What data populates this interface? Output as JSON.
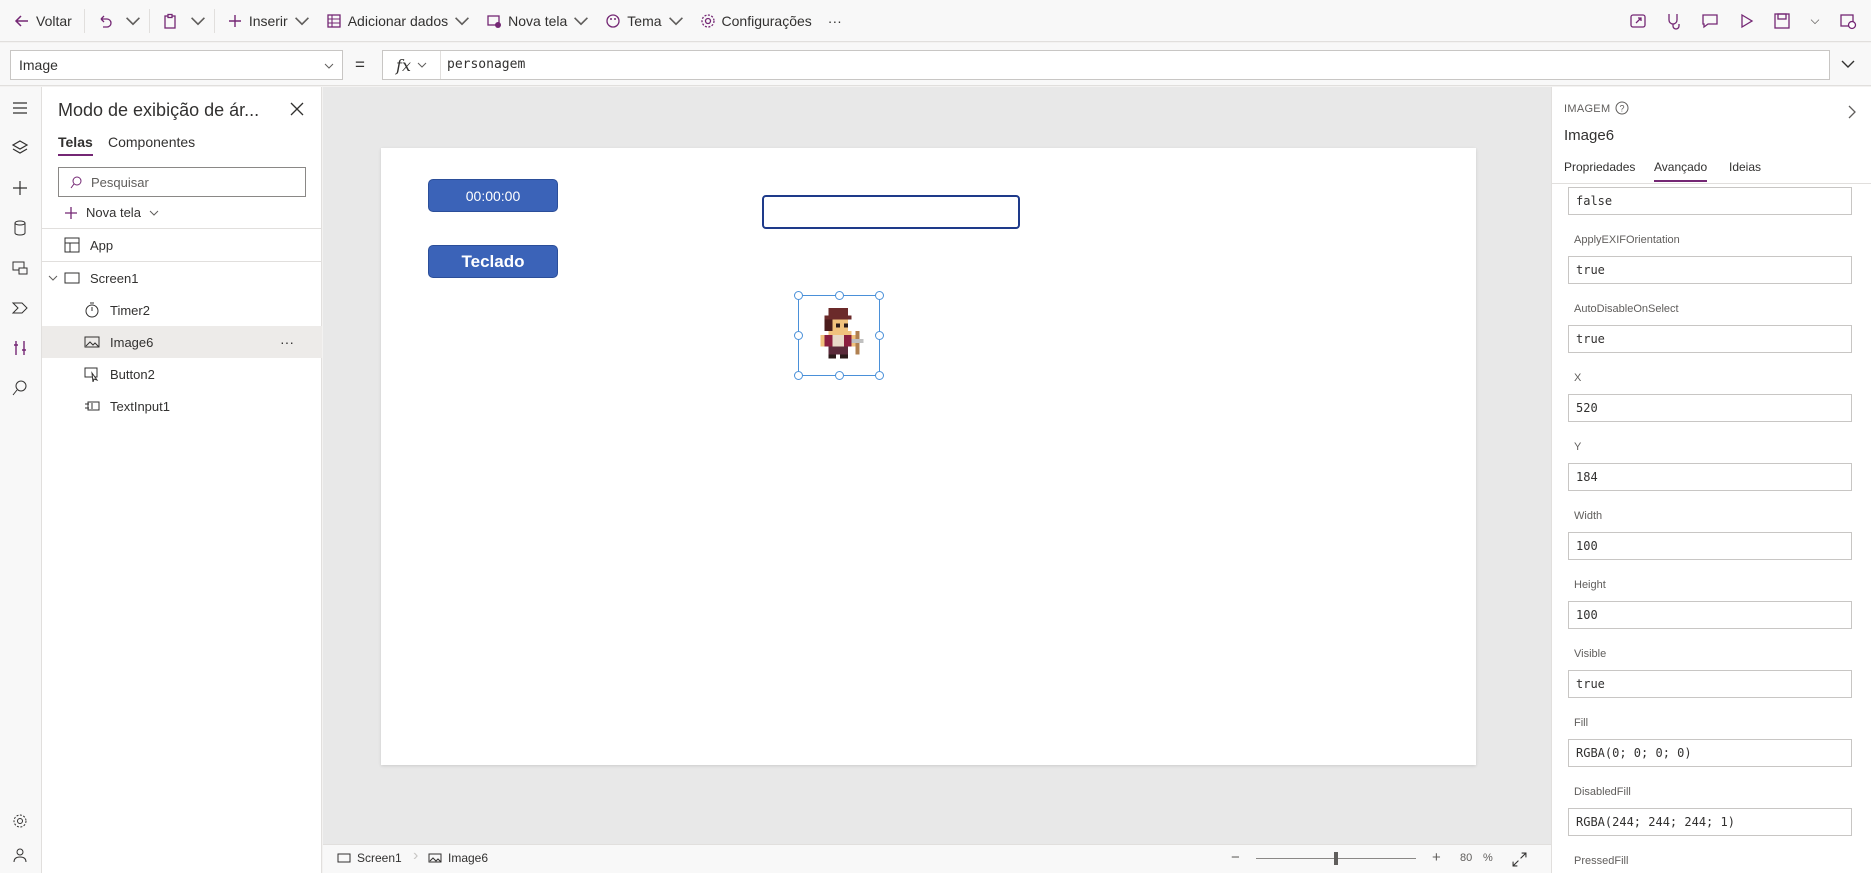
{
  "toolbar": {
    "back": "Voltar",
    "insert": "Inserir",
    "add_data": "Adicionar dados",
    "new_screen": "Nova tela",
    "theme": "Tema",
    "settings": "Configurações",
    "more": "···"
  },
  "formula": {
    "property": "Image",
    "equals": "=",
    "fx": "fx",
    "expression": "personagem"
  },
  "tree": {
    "title": "Modo de exibição de ár...",
    "tabs": [
      "Telas",
      "Componentes"
    ],
    "search_placeholder": "Pesquisar",
    "new_screen": "Nova tela",
    "items": [
      {
        "label": "App"
      },
      {
        "label": "Screen1"
      },
      {
        "label": "Timer2"
      },
      {
        "label": "Image6"
      },
      {
        "label": "Button2"
      },
      {
        "label": "TextInput1"
      }
    ],
    "selected_more": "···"
  },
  "canvas": {
    "timer_text": "00:00:00",
    "button_text": "Teclado"
  },
  "statusbar": {
    "screen": "Screen1",
    "control": "Image6",
    "zoom_value": "80",
    "zoom_unit": "%",
    "zoom_level": 0.8
  },
  "rightpanel": {
    "type": "IMAGEM",
    "name": "Image6",
    "tabs": [
      "Propriedades",
      "Avançado",
      "Ideias"
    ],
    "first_value": "false",
    "properties": [
      {
        "label": "ApplyEXIFOrientation",
        "value": "true"
      },
      {
        "label": "AutoDisableOnSelect",
        "value": "true"
      },
      {
        "label": "X",
        "value": "520"
      },
      {
        "label": "Y",
        "value": "184"
      },
      {
        "label": "Width",
        "value": "100"
      },
      {
        "label": "Height",
        "value": "100"
      },
      {
        "label": "Visible",
        "value": "true"
      },
      {
        "label": "Fill",
        "value": "RGBA(0; 0; 0; 0)"
      },
      {
        "label": "DisabledFill",
        "value": "RGBA(244; 244; 244; 1)"
      },
      {
        "label": "PressedFill",
        "value": ""
      }
    ]
  },
  "colors": {
    "accent": "#742774",
    "button_blue": "#3b63b8",
    "selection": "#4a90d9"
  }
}
